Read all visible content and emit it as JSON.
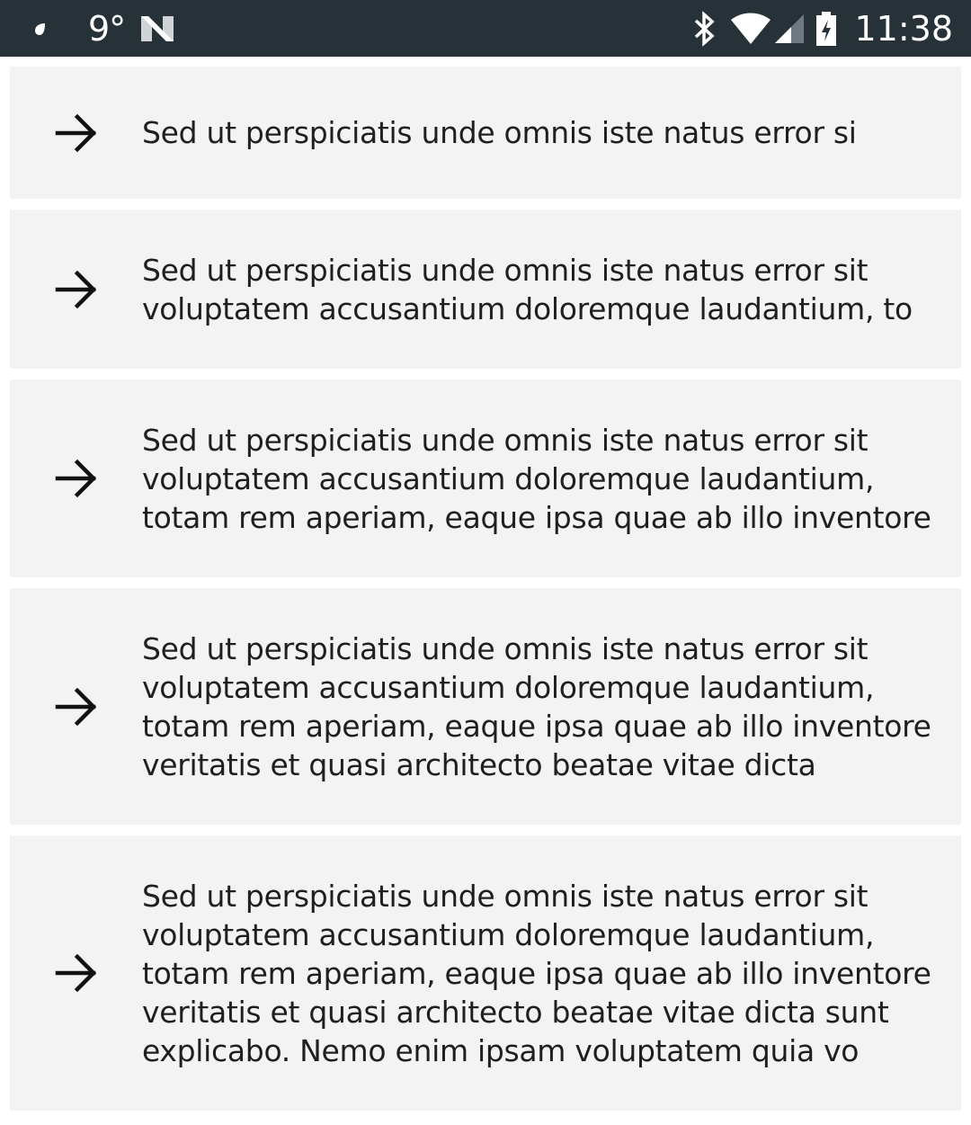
{
  "status_bar": {
    "temperature": "9°",
    "time": "11:38",
    "icons": [
      "weather-drop-icon",
      "n-notification-icon",
      "bluetooth-icon",
      "wifi-icon",
      "cell-signal-icon",
      "battery-charging-icon"
    ]
  },
  "items": [
    {
      "text": "Sed ut perspiciatis unde omnis iste natus error si",
      "icon": "arrow-right-icon"
    },
    {
      "text": "Sed ut perspiciatis unde omnis iste natus error sit voluptatem accusantium doloremque laudantium, to",
      "icon": "arrow-right-icon"
    },
    {
      "text": "Sed ut perspiciatis unde omnis iste natus error sit voluptatem accusantium doloremque laudantium, totam rem aperiam, eaque ipsa quae ab illo inventore",
      "icon": "arrow-right-icon"
    },
    {
      "text": "Sed ut perspiciatis unde omnis iste natus error sit voluptatem accusantium doloremque laudantium, totam rem aperiam, eaque ipsa quae ab illo inventore veritatis et quasi architecto beatae vitae dicta",
      "icon": "arrow-right-icon"
    },
    {
      "text": "Sed ut perspiciatis unde omnis iste natus error sit voluptatem accusantium doloremque laudantium, totam rem aperiam, eaque ipsa quae ab illo inventore veritatis et quasi architecto beatae vitae dicta sunt explicabo. Nemo enim ipsam voluptatem quia vo",
      "icon": "arrow-right-icon"
    }
  ]
}
